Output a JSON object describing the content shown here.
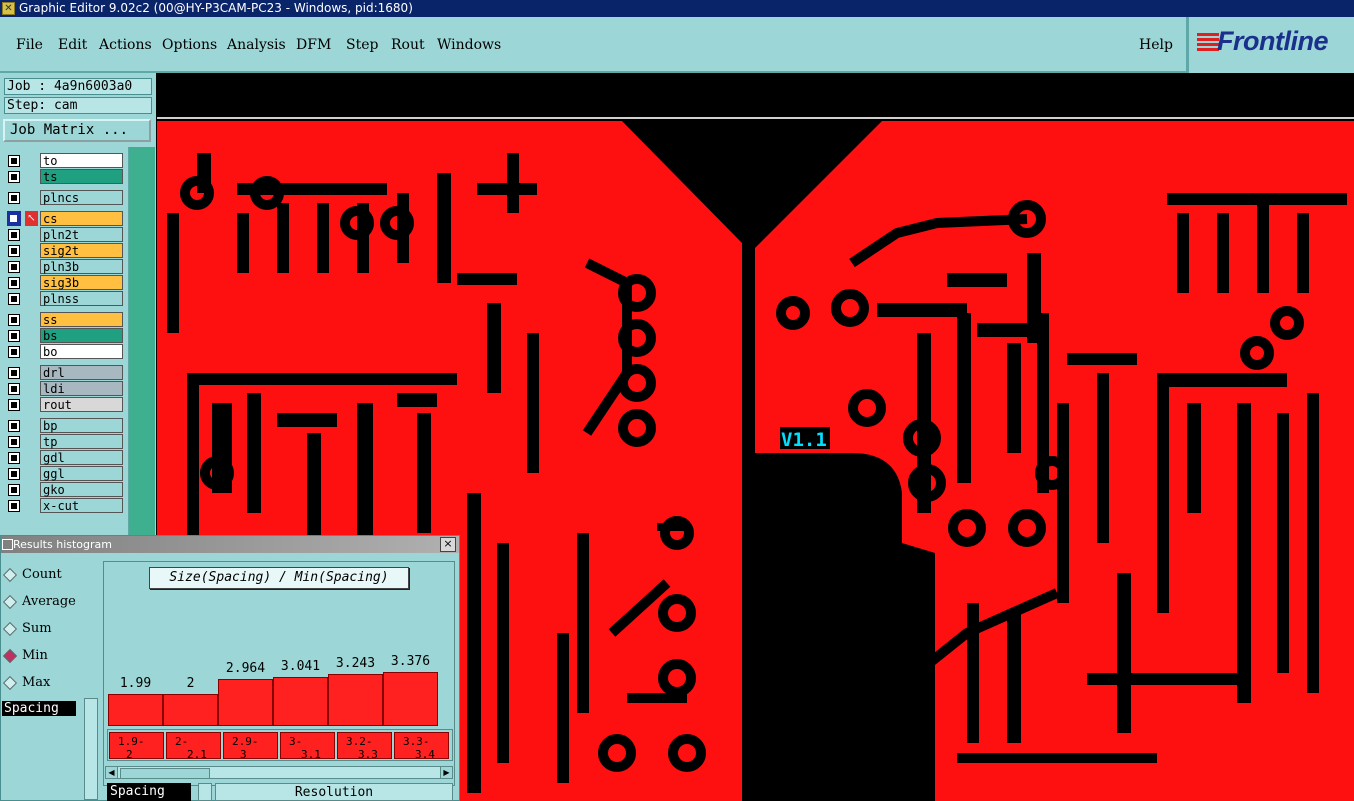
{
  "window": {
    "title": "Graphic Editor 9.02c2 (00@HY-P3CAM-PC23 - Windows, pid:1680)"
  },
  "menu": {
    "items": [
      "File",
      "Edit",
      "Actions",
      "Options",
      "Analysis",
      "DFM",
      "Step",
      "Rout",
      "Windows"
    ],
    "help": "Help"
  },
  "logo": {
    "text": "Frontline"
  },
  "job": {
    "job_label": "Job : 4a9n6003a0",
    "step_label": "Step: cam",
    "matrix_button": "Job Matrix ..."
  },
  "layers": [
    {
      "name": "to",
      "color": "#ffffff"
    },
    {
      "name": "ts",
      "color": "#1fa080"
    },
    {
      "name": "plncs",
      "color": "#9cd6d6"
    },
    {
      "name": "cs",
      "color": "#ffbf40",
      "active": true
    },
    {
      "name": "pln2t",
      "color": "#9cd6d6"
    },
    {
      "name": "sig2t",
      "color": "#ffbf40"
    },
    {
      "name": "pln3b",
      "color": "#9cd6d6"
    },
    {
      "name": "sig3b",
      "color": "#ffbf40"
    },
    {
      "name": "plnss",
      "color": "#9cd6d6"
    },
    {
      "name": "ss",
      "color": "#ffbf40"
    },
    {
      "name": "bs",
      "color": "#1fa080"
    },
    {
      "name": "bo",
      "color": "#ffffff"
    },
    {
      "name": "drl",
      "color": "#a8b8c0"
    },
    {
      "name": "ldi",
      "color": "#a8b8c0"
    },
    {
      "name": "rout",
      "color": "#d8d8d8"
    },
    {
      "name": "bp",
      "color": "#9cd6d6"
    },
    {
      "name": "tp",
      "color": "#9cd6d6"
    },
    {
      "name": "gdl",
      "color": "#9cd6d6"
    },
    {
      "name": "ggl",
      "color": "#9cd6d6"
    },
    {
      "name": "gko",
      "color": "#9cd6d6"
    },
    {
      "name": "x-cut",
      "color": "#9cd6d6"
    }
  ],
  "viewport": {
    "label": "V1.1",
    "copper_color": "#ff1010",
    "label_color": "#00e0ff"
  },
  "histogram": {
    "window_title": "Results histogram",
    "close_symbol": "×",
    "stat_options": [
      {
        "label": "Count",
        "selected": false
      },
      {
        "label": "Average",
        "selected": false
      },
      {
        "label": "Sum",
        "selected": false
      },
      {
        "label": "Min",
        "selected": true
      },
      {
        "label": "Max",
        "selected": false
      }
    ],
    "stat_field": "Spacing",
    "chart_title": "Size(Spacing) / Min(Spacing)",
    "bottom_left": "Spacing",
    "bottom_right": "Resolution"
  },
  "chart_data": {
    "type": "bar",
    "title": "Size(Spacing) / Min(Spacing)",
    "categories": [
      "1.9-2",
      "2-2.1",
      "2.9-3",
      "3-3.1",
      "3.2-3.3",
      "3.3-3.4"
    ],
    "category_lines": [
      [
        "1.9-",
        "2"
      ],
      [
        "2-",
        "2.1"
      ],
      [
        "2.9-",
        "3"
      ],
      [
        "3-",
        "3.1"
      ],
      [
        "3.2-",
        "3.3"
      ],
      [
        "3.3-",
        "3.4"
      ]
    ],
    "values": [
      1.99,
      2,
      2.964,
      3.041,
      3.243,
      3.376
    ],
    "value_labels": [
      "1.99",
      "2",
      "2.964",
      "3.041",
      "3.243",
      "3.376"
    ],
    "color": "#ff2020"
  }
}
